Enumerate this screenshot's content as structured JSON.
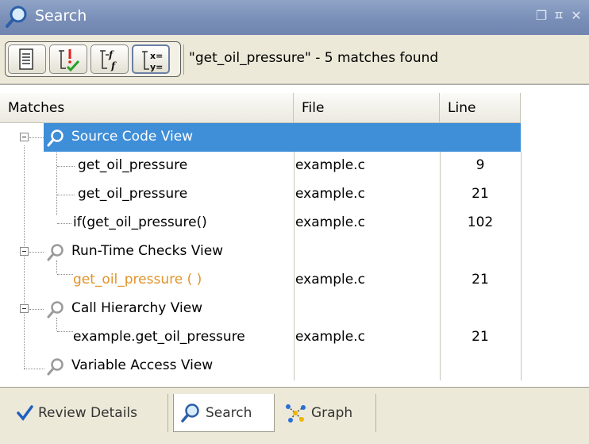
{
  "window": {
    "title": "Search",
    "buttons": [
      "restore",
      "pin",
      "close"
    ],
    "button_glyphs": [
      "❐",
      "ㅍ",
      "✕"
    ]
  },
  "toolbar": {
    "buttons": [
      {
        "name": "show-results-list",
        "icon": "list-icon"
      },
      {
        "name": "filter-checks",
        "icon": "check-filter-icon"
      },
      {
        "name": "filter-functions",
        "icon": "function-filter-icon"
      },
      {
        "name": "filter-variables",
        "icon": "variable-filter-icon"
      }
    ],
    "status": "\"get_oil_pressure\" - 5 matches found"
  },
  "table": {
    "headers": {
      "matches": "Matches",
      "file": "File",
      "line": "Line"
    },
    "groups": [
      {
        "label": "Source Code View",
        "selected": true,
        "items": [
          {
            "match": "get_oil_pressure",
            "file": "example.c",
            "line": "9"
          },
          {
            "match": "get_oil_pressure",
            "file": "example.c",
            "line": "21"
          },
          {
            "match": "if(get_oil_pressure()",
            "file": "example.c",
            "line": "102"
          }
        ]
      },
      {
        "label": "Run-Time Checks View",
        "selected": false,
        "items": [
          {
            "match": "get_oil_pressure ( )",
            "file": "example.c",
            "line": "21",
            "color": "#e0942a"
          }
        ]
      },
      {
        "label": "Call Hierarchy View",
        "selected": false,
        "items": [
          {
            "match": "example.get_oil_pressure",
            "file": "example.c",
            "line": "21"
          }
        ]
      },
      {
        "label": "Variable Access View",
        "selected": false,
        "items": []
      }
    ]
  },
  "tabs": [
    {
      "label": "Review Details",
      "icon": "checkmark-icon",
      "active": false
    },
    {
      "label": "Search",
      "icon": "search-icon",
      "active": true
    },
    {
      "label": "Graph",
      "icon": "graph-icon",
      "active": false
    }
  ],
  "colors": {
    "selection": "#3f8ed8",
    "titlebar": "#7a8fb8",
    "highlight_text": "#e0942a"
  }
}
